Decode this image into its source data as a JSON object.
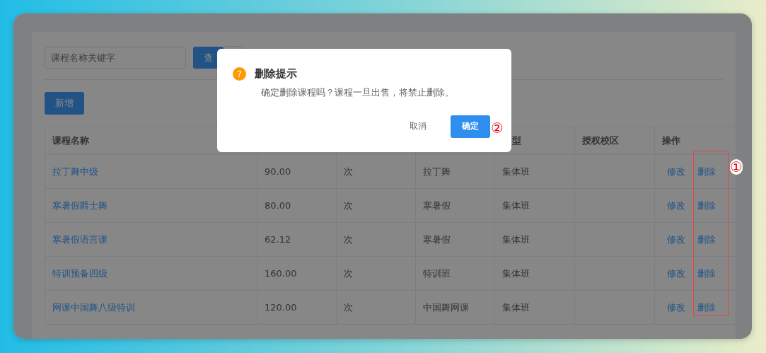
{
  "search": {
    "placeholder": "课程名称关键字"
  },
  "query_button": "查",
  "add_button": "新增",
  "table": {
    "columns": [
      {
        "label": "课程名称"
      },
      {},
      {},
      {},
      {
        "label": "型"
      },
      {
        "label": "授权校区"
      },
      {
        "label": "操作"
      }
    ],
    "rows": [
      {
        "name": "拉丁舞中级",
        "price": "90.00",
        "unit": "次",
        "category": "拉丁舞",
        "type": "集体班",
        "edit": "修改",
        "delete": "删除"
      },
      {
        "name": "寒暑假爵士舞",
        "price": "80.00",
        "unit": "次",
        "category": "寒暑假",
        "type": "集体班",
        "edit": "修改",
        "delete": "删除"
      },
      {
        "name": "寒暑假语言课",
        "price": "62.12",
        "unit": "次",
        "category": "寒暑假",
        "type": "集体班",
        "edit": "修改",
        "delete": "删除"
      },
      {
        "name": "特训预备四级",
        "price": "160.00",
        "unit": "次",
        "category": "特训班",
        "type": "集体班",
        "edit": "修改",
        "delete": "删除"
      },
      {
        "name": "网课中国舞八级特训",
        "price": "120.00",
        "unit": "次",
        "category": "中国舞网课",
        "type": "集体班",
        "edit": "修改",
        "delete": "删除"
      }
    ]
  },
  "dialog": {
    "icon": "?",
    "title": "删除提示",
    "message": "确定删除课程吗？课程一旦出售，将禁止删除。",
    "cancel": "取消",
    "confirm": "确定"
  },
  "annotations": [
    {
      "kind": "step",
      "text": "①"
    },
    {
      "kind": "step",
      "text": "②"
    }
  ]
}
